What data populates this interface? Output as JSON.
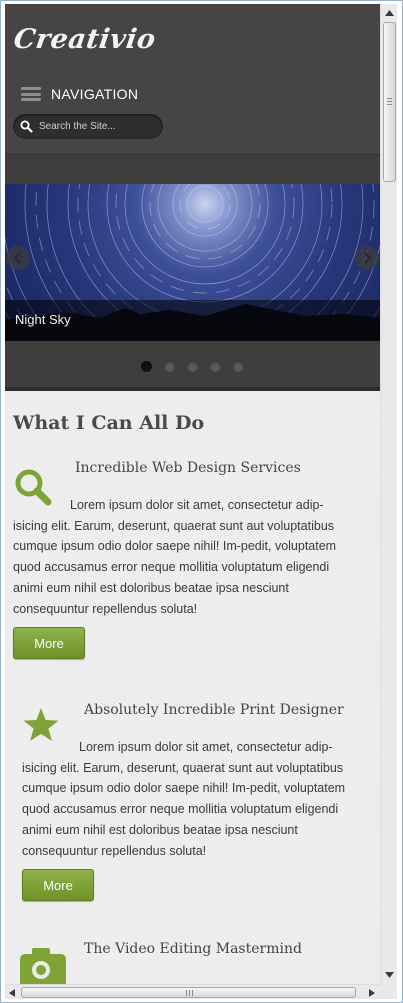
{
  "header": {
    "logo": "Creativio",
    "nav_label": "NAVIGATION",
    "search_placeholder": "Search the Site..."
  },
  "slider": {
    "caption": "Night Sky",
    "slide_count": 5,
    "active_slide": 1
  },
  "content": {
    "section_title": "What I Can All Do",
    "services": [
      {
        "icon": "magnifier-icon",
        "title": "Incredible Web Design Services",
        "body": "Lorem ipsum dolor sit amet, consectetur adip-isicing elit. Earum, deserunt, quaerat sunt aut voluptatibus cumque ipsum odio dolor saepe nihil! Im-pedit, voluptatem quod accusamus error neque mollitia voluptatum eligendi animi eum nihil est doloribus beatae ipsa nesciunt consequuntur repellendus soluta!",
        "button": "More"
      },
      {
        "icon": "star-icon",
        "title": "Absolutely Incredible Print Designer",
        "body": "Lorem ipsum dolor sit amet, consectetur adip-isicing elit. Earum, deserunt, quaerat sunt aut voluptatibus cumque ipsum odio dolor saepe nihil! Im-pedit, voluptatem quod accusamus error neque mollitia voluptatum eligendi animi eum nihil est doloribus beatae ipsa nesciunt consequuntur repellendus soluta!",
        "button": "More"
      },
      {
        "icon": "camera-icon",
        "title": "The Video Editing Mastermind"
      }
    ]
  },
  "colors": {
    "header_bg": "#464544",
    "accent_green": "#7fa336",
    "content_bg": "#ebebeb"
  }
}
